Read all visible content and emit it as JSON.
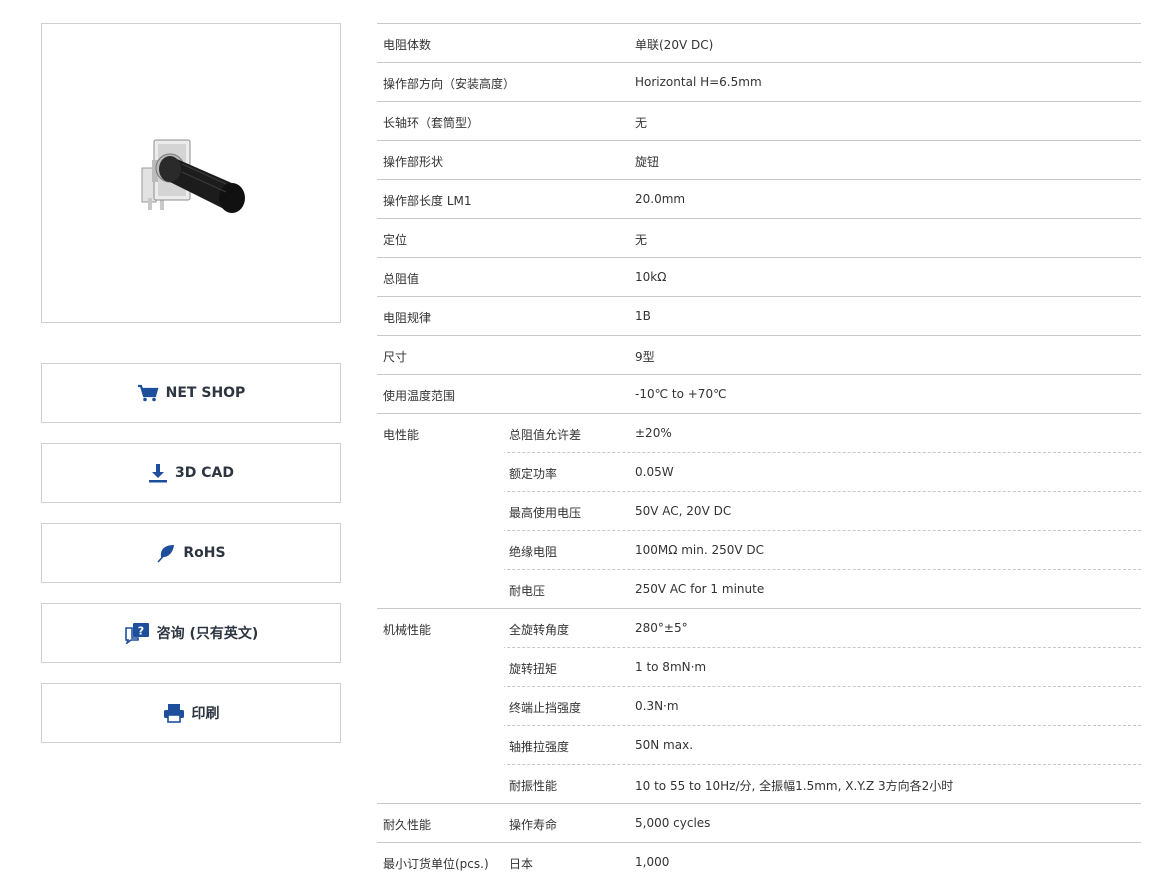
{
  "buttons": {
    "net_shop": "NET SHOP",
    "cad": "3D CAD",
    "rohs": "RoHS",
    "inquiry": "咨询 (只有英文)",
    "print": "印刷"
  },
  "colors": {
    "icon_blue": "#1e4f9c",
    "text_dark": "#2c3540",
    "border": "#cfcfcf"
  },
  "specs": [
    {
      "label": "电阻体数",
      "sub": "",
      "value": "单联(20V DC)"
    },
    {
      "label": "操作部方向（安装高度）",
      "sub": "",
      "value": "Horizontal H=6.5mm"
    },
    {
      "label": "长轴环（套筒型）",
      "sub": "",
      "value": "无"
    },
    {
      "label": "操作部形状",
      "sub": "",
      "value": "旋钮"
    },
    {
      "label": "操作部长度 LM1",
      "sub": "",
      "value": "20.0mm"
    },
    {
      "label": "定位",
      "sub": "",
      "value": "无"
    },
    {
      "label": "总阻值",
      "sub": "",
      "value": "10kΩ"
    },
    {
      "label": "电阻规律",
      "sub": "",
      "value": "1B"
    },
    {
      "label": "尺寸",
      "sub": "",
      "value": "9型"
    },
    {
      "label": "使用温度范围",
      "sub": "",
      "value": "-10℃ to +70℃"
    },
    {
      "label": "电性能",
      "sub": "总阻值允许差",
      "value": "±20%"
    },
    {
      "label": "",
      "sub": "额定功率",
      "value": "0.05W"
    },
    {
      "label": "",
      "sub": "最高使用电压",
      "value": "50V AC, 20V DC"
    },
    {
      "label": "",
      "sub": "绝缘电阻",
      "value": "100MΩ min. 250V DC"
    },
    {
      "label": "",
      "sub": "耐电压",
      "value": "250V AC for 1 minute"
    },
    {
      "label": "机械性能",
      "sub": "全旋转角度",
      "value": "280°±5°"
    },
    {
      "label": "",
      "sub": "旋转扭矩",
      "value": "1 to 8mN·m"
    },
    {
      "label": "",
      "sub": "终端止挡强度",
      "value": "0.3N·m"
    },
    {
      "label": "",
      "sub": "轴推拉强度",
      "value": "50N max."
    },
    {
      "label": "",
      "sub": "耐振性能",
      "value": "10 to 55 to 10Hz/分, 全振幅1.5mm, X.Y.Z 3方向各2小时"
    },
    {
      "label": "耐久性能",
      "sub": "操作寿命",
      "value": "5,000 cycles"
    },
    {
      "label": "最小订货单位(pcs.)",
      "sub": "日本",
      "value": "1,000"
    }
  ]
}
